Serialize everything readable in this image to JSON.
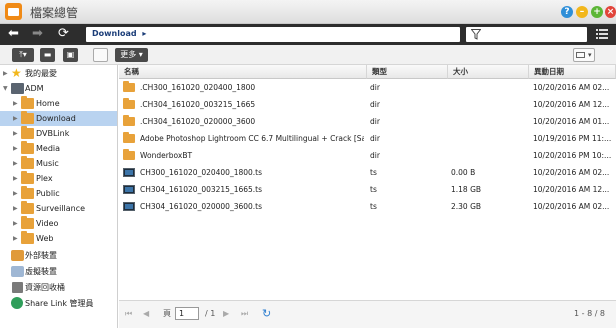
{
  "app": {
    "title": "檔案總管"
  },
  "nav": {
    "path": "Download",
    "path_arrow": "▸"
  },
  "toolbar": {
    "more_label": "更多"
  },
  "sidebar": {
    "items": [
      {
        "label": "我的最愛",
        "icon": "star-icon"
      },
      {
        "label": "ADM",
        "icon": "computer-icon"
      },
      {
        "label": "Home",
        "icon": "folder-icon"
      },
      {
        "label": "Download",
        "icon": "folder-icon",
        "selected": true
      },
      {
        "label": "DVBLink",
        "icon": "folder-icon"
      },
      {
        "label": "Media",
        "icon": "folder-icon"
      },
      {
        "label": "Music",
        "icon": "folder-icon"
      },
      {
        "label": "Plex",
        "icon": "folder-icon"
      },
      {
        "label": "Public",
        "icon": "folder-icon"
      },
      {
        "label": "Surveillance",
        "icon": "folder-icon"
      },
      {
        "label": "Video",
        "icon": "folder-icon"
      },
      {
        "label": "Web",
        "icon": "folder-icon"
      },
      {
        "label": "外部裝置",
        "icon": "external-device-icon"
      },
      {
        "label": "虛擬裝置",
        "icon": "virtual-device-icon"
      },
      {
        "label": "資源回收桶",
        "icon": "recycle-bin-icon"
      },
      {
        "label": "Share Link 管理員",
        "icon": "share-link-icon"
      }
    ]
  },
  "list": {
    "columns": [
      "名稱",
      "類型",
      "大小",
      "異動日期"
    ],
    "rows": [
      {
        "name": ".CH300_161020_020400_1800",
        "type": "dir",
        "size": "",
        "date": "10/20/2016 AM 02...",
        "icon": "folder-icon"
      },
      {
        "name": ".CH304_161020_003215_1665",
        "type": "dir",
        "size": "",
        "date": "10/20/2016 AM 12...",
        "icon": "folder-icon"
      },
      {
        "name": ".CH304_161020_020000_3600",
        "type": "dir",
        "size": "",
        "date": "10/20/2016 AM 01...",
        "icon": "folder-icon"
      },
      {
        "name": "Adobe Photoshop Lightroom CC 6.7 Multilingual + Crack [Sad...",
        "type": "dir",
        "size": "",
        "date": "10/19/2016 PM 11:...",
        "icon": "folder-icon"
      },
      {
        "name": "WonderboxBT",
        "type": "dir",
        "size": "",
        "date": "10/20/2016 PM 10:...",
        "icon": "folder-icon"
      },
      {
        "name": "CH300_161020_020400_1800.ts",
        "type": "ts",
        "size": "0.00 B",
        "date": "10/20/2016 AM 02...",
        "icon": "video-file-icon"
      },
      {
        "name": "CH304_161020_003215_1665.ts",
        "type": "ts",
        "size": "1.18 GB",
        "date": "10/20/2016 AM 12...",
        "icon": "video-file-icon"
      },
      {
        "name": "CH304_161020_020000_3600.ts",
        "type": "ts",
        "size": "2.30 GB",
        "date": "10/20/2016 AM 02...",
        "icon": "video-file-icon"
      }
    ]
  },
  "pager": {
    "page_prefix": "頁",
    "page_value": "1",
    "page_total": "/ 1",
    "range": "1 - 8 / 8"
  },
  "colors": {
    "accent": "#2d2d2d",
    "selection": "#b9d3f0",
    "folder": "#e8a23a"
  }
}
